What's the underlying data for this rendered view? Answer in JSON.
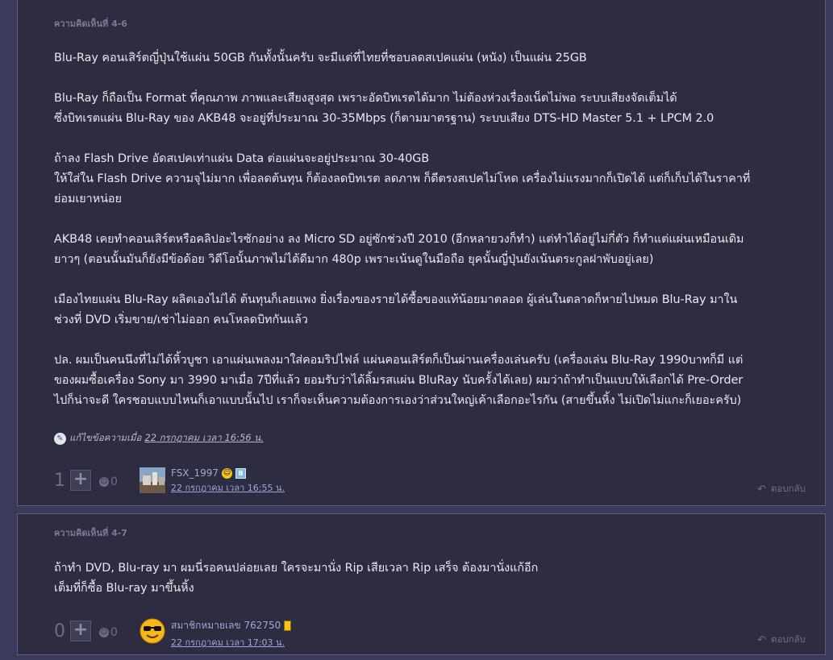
{
  "comments": [
    {
      "header": "ความคิดเห็นที่ 4-6",
      "paragraphs": [
        "Blu-Ray คอนเสิร์ตญี่ปุ่นใช้แผ่น 50GB กันทั้งนั้นครับ จะมีแต่ที่ไทยที่ชอบลดสเปคแผ่น (หนัง) เป็นแผ่น 25GB",
        "Blu-Ray ก็ถือเป็น Format ที่คุณภาพ ภาพและเสียงสูงสุด เพราะอัดบิทเรตได้มาก ไม่ต้องห่วงเรื่องเน็ตไม่พอ ระบบเสียงจัดเต็มได้\nซึ่งบิทเรตแผ่น Blu-Ray ของ AKB48 จะอยู่ที่ประมาณ 30-35Mbps (ก็ตามมาตรฐาน) ระบบเสียง DTS-HD Master 5.1 + LPCM 2.0",
        "ถ้าลง Flash Drive อัดสเปคเท่าแผ่น Data ต่อแผ่นจะอยู่ประมาณ 30-40GB\nให้ใส่ใน Flash Drive ความจุไม่มาก เพื่อลดต้นทุน ก็ต้องลดบิทเรต ลดภาพ ก็ดีตรงสเปคไม่โหด เครื่องไม่แรงมากก็เปิดได้ แต่ก็เก็บได้ในราคาที่\nย่อมเยาหน่อย",
        "AKB48 เคยทำคอนเสิร์ตหรือคลิปอะไรซักอย่าง ลง Micro SD อยู่ซักช่วงปี 2010 (อีกหลายวงก็ทำ) แต่ทำได้อยู่ไม่กี่ตัว ก็ทำแต่แผ่นเหมือนเดิม\nยาวๆ (ตอนนั้นมันก็ยังมีข้อด้อย วิดีโอนั้นภาพไม่ได้ดีมาก 480p เพราะเน้นดูในมือถือ ยุคนั้นญี่ปุ่นยังเน้นตระกูลฝาพับอยู่เลย)",
        "เมืองไทยแผ่น Blu-Ray ผลิตเองไม่ได้ ต้นทุนก็เลยแพง ยิ่งเรื่องของรายได้ซื้อของแท้น้อยมาตลอด ผู้เล่นในตลาดก็หายไปหมด Blu-Ray มาใน\nช่วงที่ DVD เริ่มขาย/เช่าไม่ออก คนโหลดบิทกันแล้ว",
        "ปล. ผมเป็นคนนึงที่ไม่ได้หิ้วบูชา เอาแผ่นเพลงมาใส่คอมริปไฟล์ แผ่นคอนเสิร์ตก็เป็นผ่านเครื่องเล่นครับ (เครื่องเล่น Blu-Ray 1990บาทก็มี แต่\nของผมซื้อเครื่อง Sony มา 3990 มาเมื่อ 7ปีที่แล้ว ยอมรับว่าได้ลิ้มรสแผ่น BluRay นับครั้งได้เลย) ผมว่าถ้าทำเป็นแบบให้เลือกได้ Pre-Order\nไปก็น่าจะดี ใครชอบแบบไหนก็เอาแบบนั้นไป เราก็จะเห็นความต้องการเองว่าส่วนใหญ่เค้าเลือกอะไรกัน (สายขึ้นหิ้ง ไม่เปิดไม่แกะก็เยอะครับ)"
      ],
      "edit_prefix": "แก้ไขข้อความเมื่อ",
      "edit_time": "22 กรกฎาคม เวลา 16:56 น.",
      "vote_count": "1",
      "emotion_count": "0",
      "username": "FSX_1997",
      "timestamp": "22 กรกฎาคม เวลา 16:55 น.",
      "reply_label": "ตอบกลับ"
    },
    {
      "header": "ความคิดเห็นที่ 4-7",
      "paragraphs": [
        "ถ้าทำ DVD, Blu-ray มา ผมนี่รอคนปล่อยเลย ใครจะมานั่ง Rip เสียเวลา Rip เสร็จ ต้องมานั่งแก้อีก\nเต็มที่ก็ซื้อ Blu-ray มาขึ้นหิ้ง"
      ],
      "vote_count": "0",
      "emotion_count": "0",
      "username": "สมาชิกหมายเลข 762750",
      "timestamp": "22 กรกฎาคม เวลา 17:03 น.",
      "reply_label": "ตอบกลับ"
    }
  ],
  "icons": {
    "plus": "plus-icon",
    "emotion": "emotion-icon",
    "reply": "reply-arrow-icon",
    "edit": "edit-icon"
  }
}
